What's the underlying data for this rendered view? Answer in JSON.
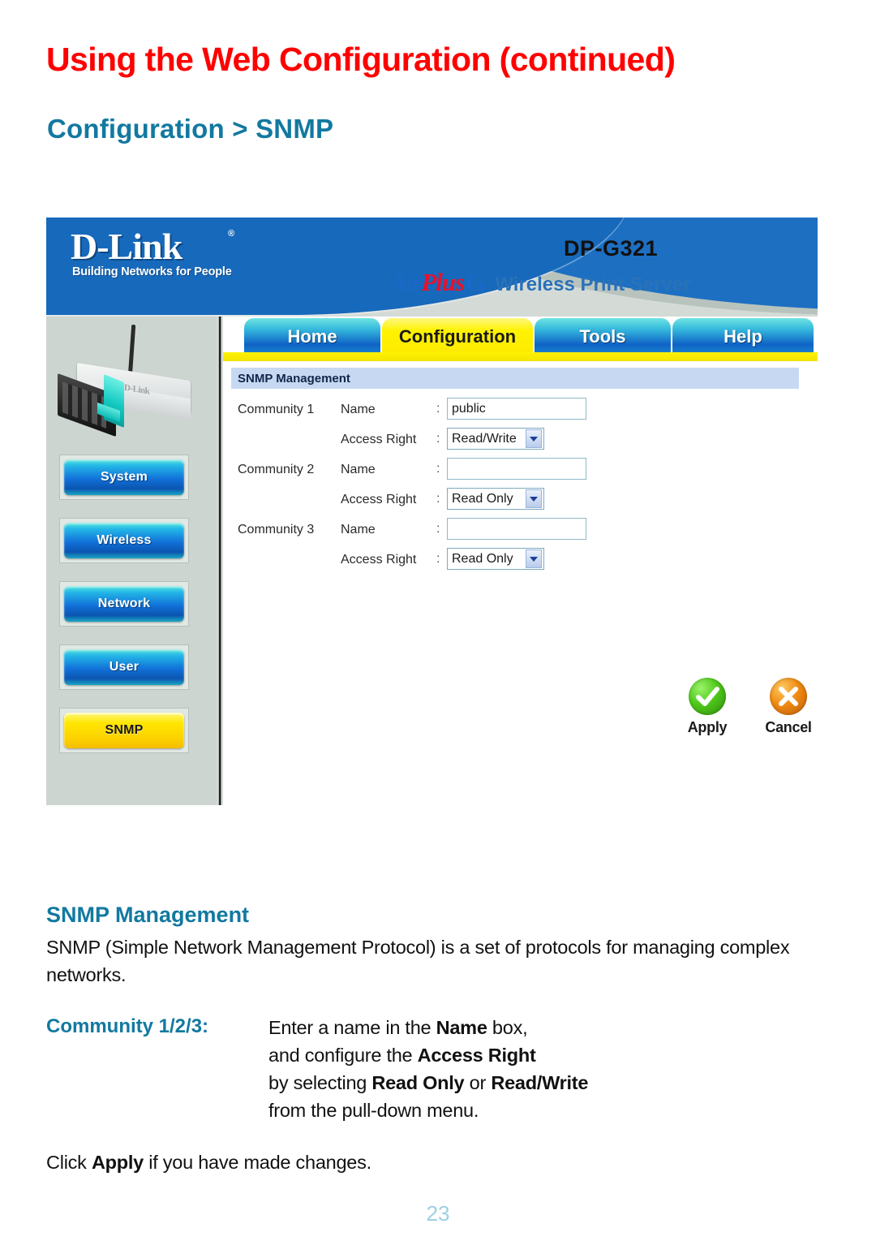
{
  "page": {
    "title": "Using the Web Configuration (continued)",
    "section": "Configuration > SNMP",
    "number": "23",
    "colors": {
      "title_red": "#FF0000",
      "heading_teal": "#1279A0",
      "page_number": "#9ecfe3"
    }
  },
  "screenshot": {
    "brand": {
      "logo": "D-Link",
      "registered": "®",
      "tagline": "Building Networks for People",
      "model": "DP-G321",
      "air": "Air",
      "plus": "Plus",
      "g": "G",
      "product": "Wireless Print Server"
    },
    "tabs": [
      {
        "label": "Home",
        "active": false
      },
      {
        "label": "Configuration",
        "active": true
      },
      {
        "label": "Tools",
        "active": false
      },
      {
        "label": "Help",
        "active": false
      }
    ],
    "sidebar": {
      "device_label": "D-Link",
      "items": [
        {
          "label": "System",
          "active": false
        },
        {
          "label": "Wireless",
          "active": false
        },
        {
          "label": "Network",
          "active": false
        },
        {
          "label": "User",
          "active": false
        },
        {
          "label": "SNMP",
          "active": true
        }
      ]
    },
    "form": {
      "section_header": "SNMP Management",
      "separator": ":",
      "rows": [
        {
          "community": "Community 1",
          "field": "Name",
          "type": "text",
          "value": "public",
          "placeholder": ""
        },
        {
          "community": "",
          "field": "Access Right",
          "type": "select",
          "value": "Read/Write"
        },
        {
          "community": "Community 2",
          "field": "Name",
          "type": "text",
          "value": "",
          "placeholder": ""
        },
        {
          "community": "",
          "field": "Access Right",
          "type": "select",
          "value": "Read Only"
        },
        {
          "community": "Community 3",
          "field": "Name",
          "type": "text",
          "value": "",
          "placeholder": ""
        },
        {
          "community": "",
          "field": "Access Right",
          "type": "select",
          "value": "Read Only"
        }
      ],
      "access_right_options": [
        "Read Only",
        "Read/Write"
      ]
    },
    "actions": [
      {
        "label": "Apply",
        "icon": "check-circle-icon"
      },
      {
        "label": "Cancel",
        "icon": "x-circle-icon"
      }
    ]
  },
  "body": {
    "heading": "SNMP Management",
    "paragraph": "SNMP (Simple Network Management Protocol) is a set of protocols for managing complex networks.",
    "term": "Community 1/2/3:",
    "definition_lines": [
      {
        "parts": [
          {
            "t": "Enter a name in the ",
            "b": false
          },
          {
            "t": "Name",
            "b": true
          },
          {
            "t": " box,",
            "b": false
          }
        ]
      },
      {
        "parts": [
          {
            "t": "and configure the ",
            "b": false
          },
          {
            "t": "Access Right",
            "b": true
          }
        ]
      },
      {
        "parts": [
          {
            "t": "by selecting ",
            "b": false
          },
          {
            "t": "Read Only",
            "b": true
          },
          {
            "t": " or ",
            "b": false
          },
          {
            "t": "Read/Write",
            "b": true
          }
        ]
      },
      {
        "parts": [
          {
            "t": "from the pull-down menu.",
            "b": false
          }
        ]
      }
    ],
    "closing": {
      "parts": [
        {
          "t": "Click ",
          "b": false
        },
        {
          "t": "Apply",
          "b": true
        },
        {
          "t": " if you have made changes.",
          "b": false
        }
      ]
    }
  }
}
